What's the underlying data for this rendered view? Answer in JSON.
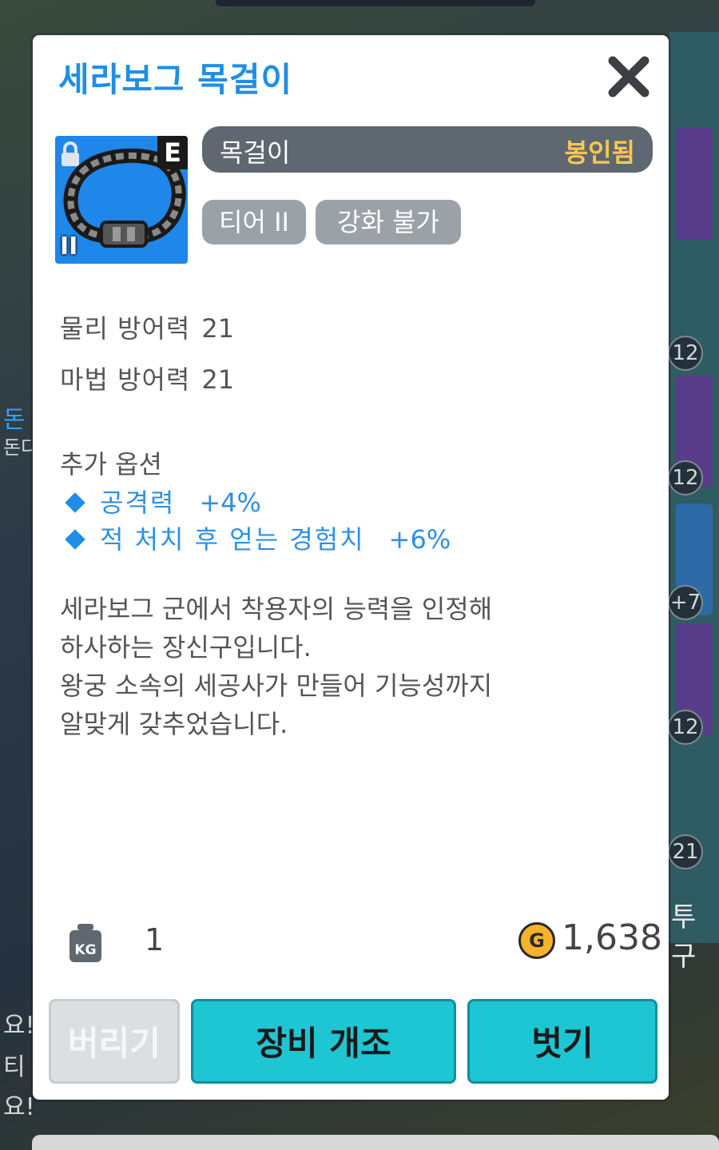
{
  "item": {
    "name": "세라보그 목걸이",
    "type": "목걸이",
    "binding": "봉인됨",
    "grade_badge": "E",
    "tier_mark": "II",
    "tags": [
      "티어 II",
      "강화 불가"
    ]
  },
  "stats": [
    {
      "name": "물리 방어력",
      "value": "21"
    },
    {
      "name": "마법 방어력",
      "value": "21"
    }
  ],
  "additional_options": {
    "title": "추가 옵션",
    "items": [
      {
        "name": "공격력",
        "value": "+4%"
      },
      {
        "name": "적 처치 후 얻는 경험치",
        "value": "+6%"
      }
    ]
  },
  "description": [
    "세라보그 군에서 착용자의 능력을 인정해",
    "하사하는 장신구입니다.",
    "왕궁 소속의 세공사가 만들어 기능성까지",
    "알맞게 갖추었습니다."
  ],
  "footer": {
    "weight_icon_label": "KG",
    "weight": "1",
    "gold_icon_label": "G",
    "price": "1,638"
  },
  "buttons": {
    "discard": "버리기",
    "modify": "장비 개조",
    "unequip": "벗기"
  },
  "background": {
    "badges": [
      "12",
      "12",
      "+7",
      "12",
      "21"
    ],
    "left_texts": [
      "돈",
      "돈다",
      "요!",
      "티",
      "요!"
    ],
    "bubble_text": "투구"
  },
  "colors": {
    "title": "#1f8fe6",
    "binding": "#ffc84a",
    "option": "#2d8fe8",
    "button_primary": "#1ec5d3",
    "button_disabled": "#dcdfe1",
    "icon_bg": "#1f86ea"
  },
  "icons": [
    "close-icon",
    "lock-icon",
    "necklace-icon",
    "diamond-icon",
    "weight-icon",
    "gold-coin-icon"
  ]
}
